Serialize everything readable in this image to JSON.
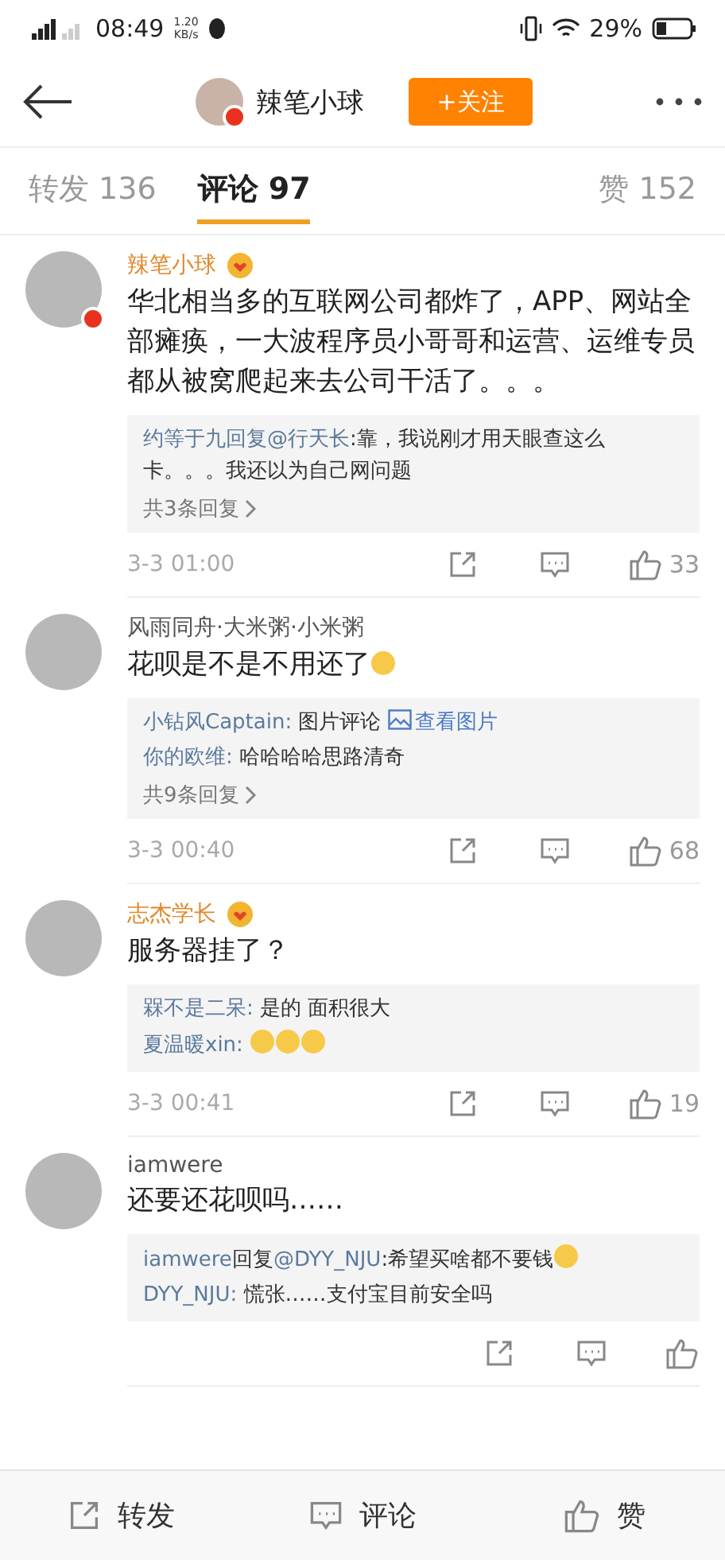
{
  "status_bar": {
    "time": "08:49",
    "speed": "1.20",
    "speed_unit": "KB/s",
    "battery": "29%"
  },
  "header": {
    "name": "辣笔小球",
    "follow_button": "+关注"
  },
  "tabs": [
    {
      "label": "转发 136",
      "selected": false
    },
    {
      "label": "评论 97",
      "selected": true
    },
    {
      "label": "赞 152",
      "selected": false
    }
  ],
  "comments": [
    {
      "author": "辣笔小球",
      "vip": true,
      "verified": true,
      "text": "华北相当多的互联网公司都炸了，APP、网站全部瘫痪，一大波程序员小哥哥和运营、运维专员都从被窝爬起来去公司干活了。。。",
      "replies": [
        {
          "parts": [
            {
              "kind": "name",
              "text": "约等于九"
            },
            {
              "kind": "plain",
              "text": "回复"
            },
            {
              "kind": "name",
              "text": "@行天长"
            },
            {
              "kind": "text",
              "text": ":靠，我说刚才用天眼查这么卡。。。我还以为自己网问题"
            }
          ]
        }
      ],
      "more": "共3条回复",
      "time": "3-3 01:00",
      "likes": "33"
    },
    {
      "author": "风雨同舟·大米粥·小米粥",
      "vip": false,
      "text": "花呗是不是不用还了",
      "text_emoji": true,
      "replies": [
        {
          "parts": [
            {
              "kind": "name",
              "text": "小钻风Captain: "
            },
            {
              "kind": "text",
              "text": "图片评论 "
            },
            {
              "kind": "link",
              "text": "查看图片"
            }
          ]
        },
        {
          "parts": [
            {
              "kind": "name",
              "text": "你的欧维: "
            },
            {
              "kind": "text",
              "text": "哈哈哈哈思路清奇"
            }
          ]
        }
      ],
      "more": "共9条回复",
      "time": "3-3 00:40",
      "likes": "68"
    },
    {
      "author": "志杰学长",
      "vip": true,
      "text": "服务器挂了？",
      "replies": [
        {
          "parts": [
            {
              "kind": "name",
              "text": "槑不是二呆: "
            },
            {
              "kind": "text",
              "text": "是的 面积很大"
            }
          ]
        },
        {
          "parts": [
            {
              "kind": "name",
              "text": "夏温暖xin: "
            },
            {
              "kind": "emoji"
            },
            {
              "kind": "emoji"
            },
            {
              "kind": "emoji"
            }
          ]
        }
      ],
      "time": "3-3 00:41",
      "likes": "19"
    },
    {
      "author": "iamwere",
      "vip": false,
      "text": "还要还花呗吗……",
      "replies": [
        {
          "parts": [
            {
              "kind": "name",
              "text": "iamwere"
            },
            {
              "kind": "text",
              "text": "回复"
            },
            {
              "kind": "name",
              "text": "@DYY_NJU"
            },
            {
              "kind": "text",
              "text": ":希望买啥都不要钱"
            },
            {
              "kind": "emoji"
            }
          ]
        },
        {
          "parts": [
            {
              "kind": "name",
              "text": "DYY_NJU: "
            },
            {
              "kind": "text",
              "text": "慌张……支付宝目前安全吗"
            }
          ]
        }
      ]
    }
  ],
  "bottom_bar": [
    "转发",
    "评论",
    "赞"
  ]
}
